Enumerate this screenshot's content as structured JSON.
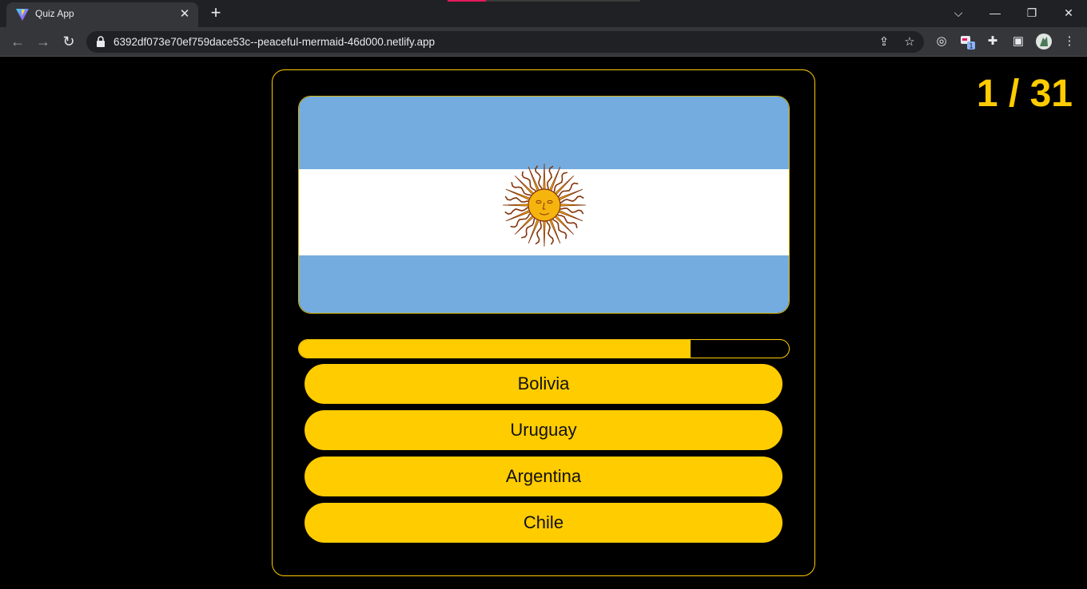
{
  "browser": {
    "tab_title": "Quiz App",
    "url": "6392df073e70ef759dace53c--peaceful-mermaid-46d000.netlify.app",
    "extension_badge": "1"
  },
  "quiz": {
    "counter": "1 / 31",
    "progress": 0.8,
    "flag": {
      "country": "Argentina",
      "colors": {
        "sky_blue": "#74acdf",
        "white": "#ffffff",
        "sun": "#f6b40e",
        "sun_outline": "#85340a"
      }
    },
    "options": [
      "Bolivia",
      "Uruguay",
      "Argentina",
      "Chile"
    ]
  },
  "colors": {
    "accent": "#ffcc00",
    "background": "#000000"
  }
}
